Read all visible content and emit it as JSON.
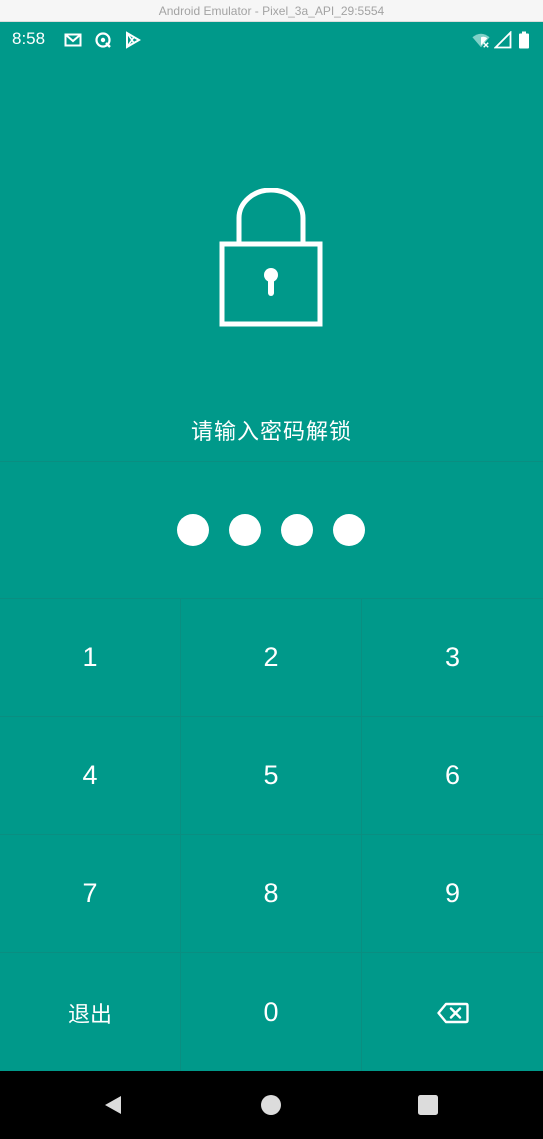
{
  "window": {
    "title": "Android Emulator - Pixel_3a_API_29:5554"
  },
  "status_bar": {
    "time": "8:58",
    "left_icons": [
      "gmail-icon",
      "sync-icon",
      "play-store-icon"
    ],
    "right_icons": [
      "wifi-icon",
      "signal-icon",
      "battery-icon"
    ]
  },
  "lock_screen": {
    "icon": "padlock-icon",
    "prompt": "请输入密码解锁",
    "entered_digits": 4
  },
  "keypad": {
    "keys": [
      "1",
      "2",
      "3",
      "4",
      "5",
      "6",
      "7",
      "8",
      "9"
    ],
    "exit_label": "退出",
    "zero_label": "0",
    "delete_icon": "backspace-icon"
  },
  "navigation": {
    "buttons": [
      "back-icon",
      "home-icon",
      "recents-icon"
    ]
  },
  "colors": {
    "background": "#00998a",
    "divider": "#0a8e81",
    "foreground": "#ffffff"
  }
}
